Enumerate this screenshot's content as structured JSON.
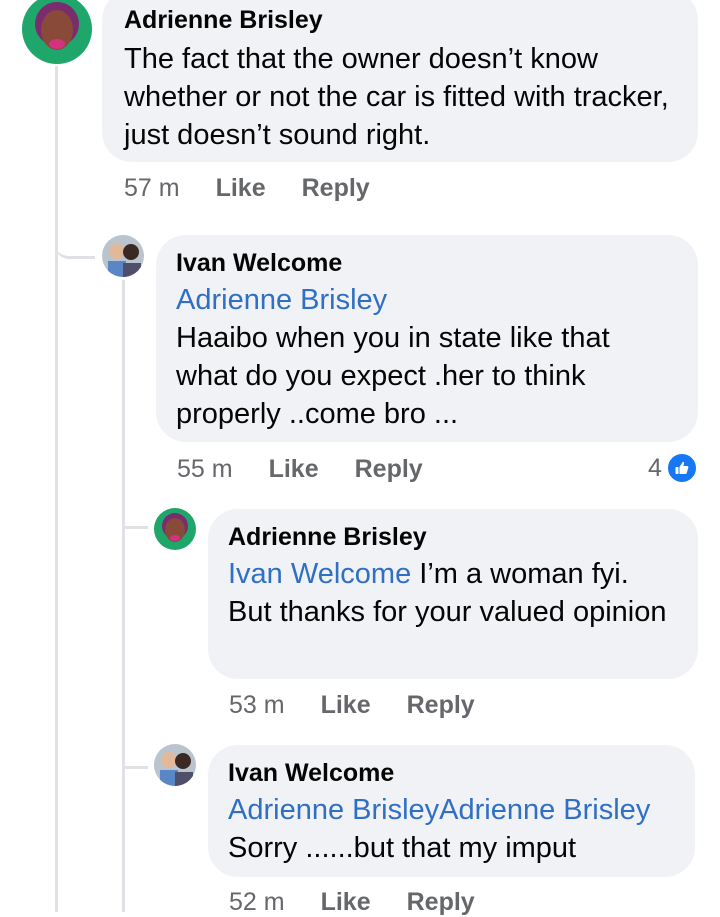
{
  "comments": [
    {
      "author": "Adrienne Brisley",
      "mention": "",
      "text": "The fact that the owner doesn’t know whether or not the car is fitted with tracker, just doesn’t sound right.",
      "time": "57 m",
      "like_label": "Like",
      "reply_label": "Reply"
    },
    {
      "author": "Ivan Welcome",
      "mention": "Adrienne Brisley",
      "text": "Haaibo when you in state like that what do you expect .her to think properly ..come bro ...",
      "time": "55 m",
      "like_label": "Like",
      "reply_label": "Reply",
      "reaction_count": "4",
      "reaction_icon": "thumbs-up-icon",
      "reaction_color": "#1877f2"
    },
    {
      "author": "Adrienne Brisley",
      "mention": "Ivan Welcome",
      "text": " I’m a woman fyi. But thanks for your valued opinion",
      "time": "53 m",
      "like_label": "Like",
      "reply_label": "Reply"
    },
    {
      "author": "Ivan Welcome",
      "mention": "Adrienne BrisleyAdrienne Brisley",
      "text": "Sorry ......but that my imput",
      "time": "52 m",
      "like_label": "Like",
      "reply_label": "Reply"
    }
  ],
  "colors": {
    "bubble": "#f0f2f5",
    "mention": "#2f6fc4",
    "meta": "#65676b"
  }
}
